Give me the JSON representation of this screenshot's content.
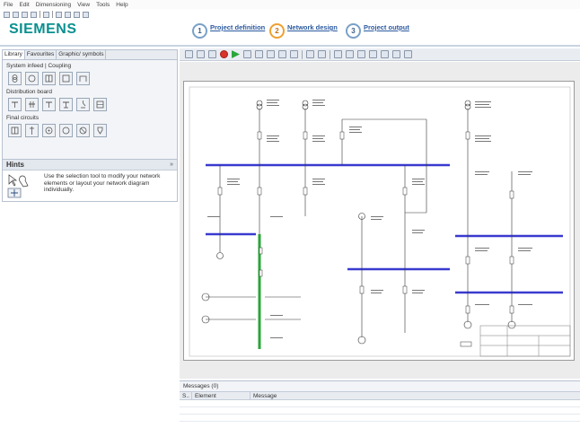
{
  "menu": [
    "File",
    "Edit",
    "Dimensioning",
    "View",
    "Tools",
    "Help"
  ],
  "logo": "SIEMENS",
  "steps": [
    {
      "num": "1",
      "label": "Project definition"
    },
    {
      "num": "2",
      "label": "Network design"
    },
    {
      "num": "3",
      "label": "Project output"
    }
  ],
  "library_tabs": [
    "Library",
    "Favourites",
    "Graphic/ symbols"
  ],
  "groups": {
    "system_infeed": "System infeed | Coupling",
    "distribution": "Distribution board",
    "final": "Final circuits"
  },
  "hints": {
    "title": "Hints",
    "close": "»",
    "text": "Use the selection tool to modify your network elements or layout your network diagram individually."
  },
  "messages": {
    "title": "Messages (0)",
    "columns": [
      "S..",
      "Element",
      "Message"
    ]
  },
  "colors": {
    "brand": "#0a8f8f",
    "busbar": "#3a3ad0",
    "selected": "#2aa63a",
    "step_active": "#f0a030"
  }
}
